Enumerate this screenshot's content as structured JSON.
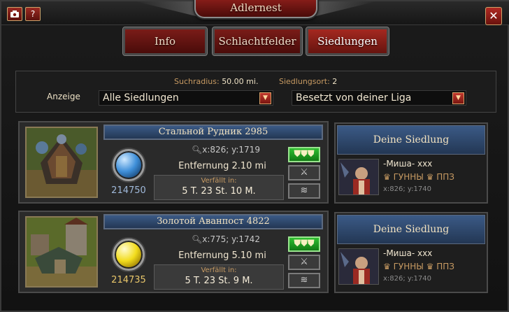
{
  "window": {
    "title": "Adlernest",
    "camera_icon": "camera-icon",
    "help_label": "?",
    "close_label": "✕"
  },
  "tabs": [
    {
      "label": "Info",
      "active": false
    },
    {
      "label": "Schlachtfelder",
      "active": false
    },
    {
      "label": "Siedlungen",
      "active": true
    }
  ],
  "filter": {
    "radius_label": "Suchradius:",
    "radius_value": "50.00 mi.",
    "location_label": "Siedlungsort:",
    "location_value": "2",
    "display_label": "Anzeige",
    "display_selected": "Alle Siedlungen",
    "owner_selected": "Besetzt von deiner Liga"
  },
  "settlements": [
    {
      "name": "Стальной Рудник 2985",
      "resource_type": "blue",
      "resource_value": "214750",
      "coords": "x:826; y:1719",
      "distance": "Entfernung 2.10 mi",
      "expires_label": "Verfällt in:",
      "expires_value": "5 T. 23 St. 10 M.",
      "owner_panel": {
        "header": "Deine Siedlung",
        "player": "-Миша- xxx",
        "alliance": "♛ ГУННЫ ♛ ППЗ",
        "coords": "x:826; y:1740"
      }
    },
    {
      "name": "Золотой Аванпост 4822",
      "resource_type": "gold",
      "resource_value": "214735",
      "coords": "x:775; y:1742",
      "distance": "Entfernung 5.10 mi",
      "expires_label": "Verfällt in:",
      "expires_value": "5 T. 23 St. 9 M.",
      "owner_panel": {
        "header": "Deine Siedlung",
        "player": "-Миша- xxx",
        "alliance": "♛ ГУННЫ ♛ ППЗ",
        "coords": "x:826; y:1740"
      }
    }
  ],
  "icons": {
    "reinforce": "shield-icon",
    "attack": "crossed-swords-icon",
    "spy": "eagle-wing-icon"
  },
  "colors": {
    "accent_red": "#8a1e1a",
    "panel_blue": "#3b5a86",
    "active_green": "#2fbf30"
  }
}
